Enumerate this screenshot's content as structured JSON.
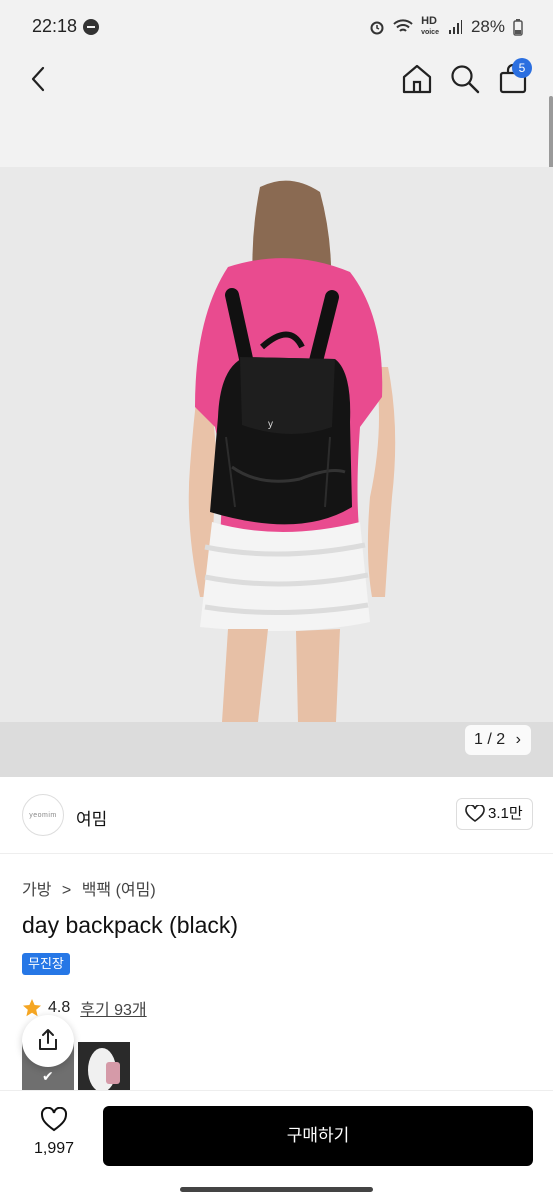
{
  "status": {
    "time": "22:18",
    "hd_label": "HD",
    "hd_sub": "voice",
    "battery": "28%"
  },
  "nav": {
    "cart_count": "5"
  },
  "gallery": {
    "counter": "1 / 2"
  },
  "shop": {
    "logo_text": "yeomim",
    "name": "여밈",
    "likes": "3.1만"
  },
  "product": {
    "breadcrumb": [
      "가방",
      ">",
      "백팩 (여밈)"
    ],
    "title": "day backpack (black)",
    "tag": "무진장",
    "rating": "4.8",
    "reviews": "후기 93개"
  },
  "bottom": {
    "wish_count": "1,997",
    "buy_label": "구매하기"
  },
  "colors": {
    "accent": "#2677e6",
    "badge": "#2b6fe0",
    "buy_button": "#000000",
    "star": "#f5a623"
  }
}
